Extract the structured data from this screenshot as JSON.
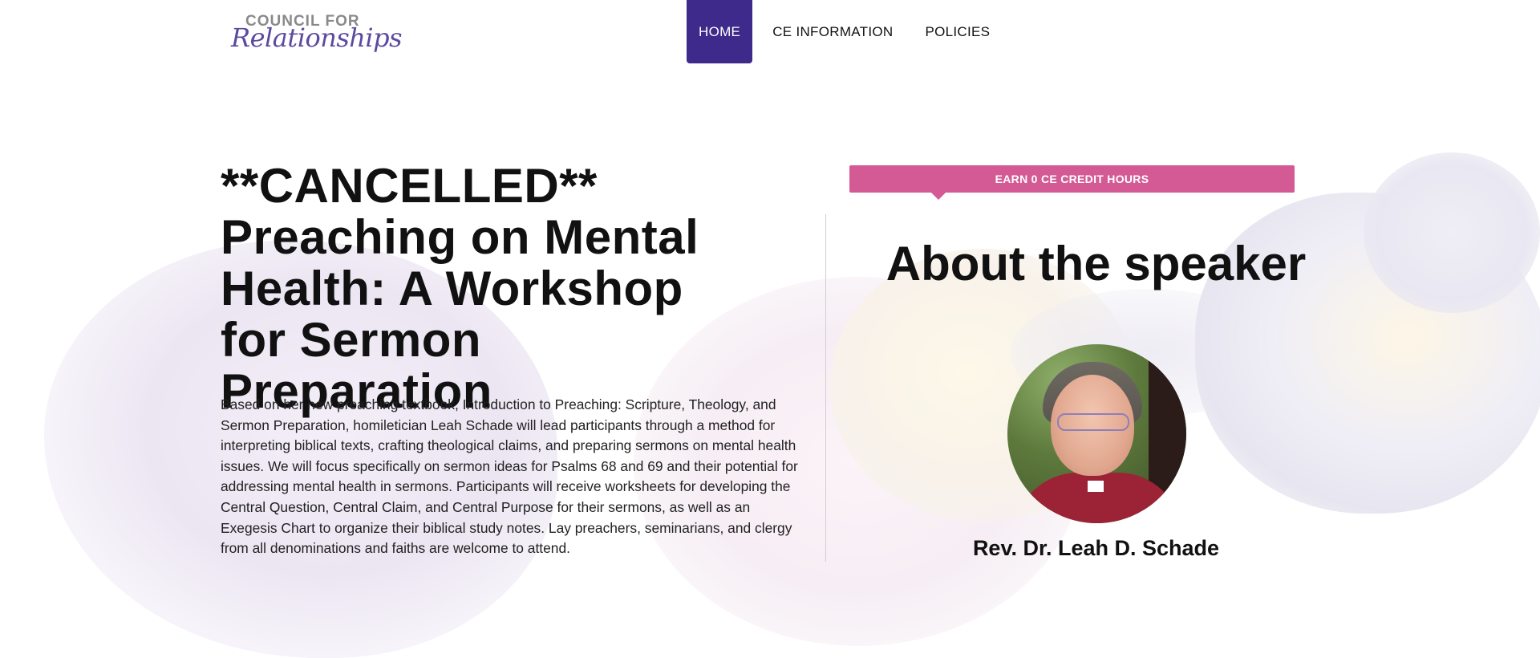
{
  "header": {
    "logo": {
      "top_text": "COUNCIL FOR",
      "script_text": "Relationships"
    },
    "nav": [
      {
        "label": "HOME",
        "active": true
      },
      {
        "label": "CE INFORMATION",
        "active": false
      },
      {
        "label": "POLICIES",
        "active": false
      }
    ]
  },
  "event": {
    "title": "**CANCELLED** Preaching on Mental Health: A Workshop for Sermon Preparation",
    "description": "Based on her new preaching textbook, Introduction to Preaching: Scripture, Theology, and Sermon Preparation, homiletician Leah Schade will lead participants through a method for interpreting biblical texts, crafting theological claims, and preparing sermons on mental health issues. We will focus specifically on sermon ideas for Psalms 68 and 69 and their potential for addressing mental health in sermons. Participants will receive worksheets for developing the Central Question, Central Claim, and Central Purpose for their sermons, as well as an Exegesis Chart to organize their biblical study notes. Lay preachers, seminarians, and clergy from all denominations and faiths are welcome to attend."
  },
  "sidebar": {
    "ce_banner": "EARN 0 CE CREDIT HOURS",
    "about_heading": "About the speaker",
    "speaker_name": "Rev. Dr. Leah D. Schade"
  },
  "colors": {
    "nav_active": "#3d2a8a",
    "ce_banner": "#d35a95",
    "logo_script": "#5b4aa0"
  }
}
